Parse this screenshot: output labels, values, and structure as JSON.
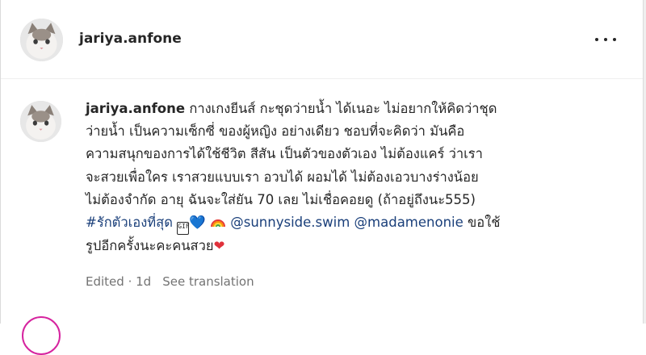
{
  "post_header": {
    "username": "jariya.anfone",
    "avatar_icon": "cat-avatar",
    "more_icon": "more-options-icon"
  },
  "comment": {
    "username": "jariya.anfone",
    "line1_text": " กางเกงยีนส์ กะชุดว่ายน้ำ ได้เนอะ ไม่อยากให้คิดว่าชุด",
    "line2_text": "ว่ายน้ำ เป็นความเซ็กซี่ ของผู้หญิง อย่างเดียว ชอบที่จะคิดว่า มันคือ",
    "line3_text": "ความสนุกของการได้ใช้ชีวิต สีสัน เป็นตัวของตัวเอง ไม่ต้องแคร์ ว่าเรา",
    "line4_text": "จะสวยเพื่อใคร เราสวยแบบเรา อวบได้ ผอมได้ ไม่ต้องเอวบางร่างน้อย",
    "line5_text": "ไม่ต้องจำกัด อายุ ฉันจะใส่ยัน 70 เลย ไม่เชื่อคอยดู (ถ้าอยู่ถึงนะ555)",
    "hashtag": "#รักตัวเองที่สุด",
    "gif_label": "GIF",
    "blue_heart": "💙",
    "mention1": "@sunnyside.swim",
    "mention2": "@madamenonie",
    "line6_tail": " ขอใช้",
    "line7_text": "รูปอีกครั้งนะคะคนสวย",
    "red_heart": "❤",
    "colors": {
      "link": "#1a3f7a",
      "meta": "#737373",
      "blue_heart": "#2b7bd5",
      "red_heart": "#e0313b"
    }
  },
  "meta": {
    "edited": "Edited",
    "separator": " · ",
    "age": "1d",
    "see_translation": "See translation"
  }
}
